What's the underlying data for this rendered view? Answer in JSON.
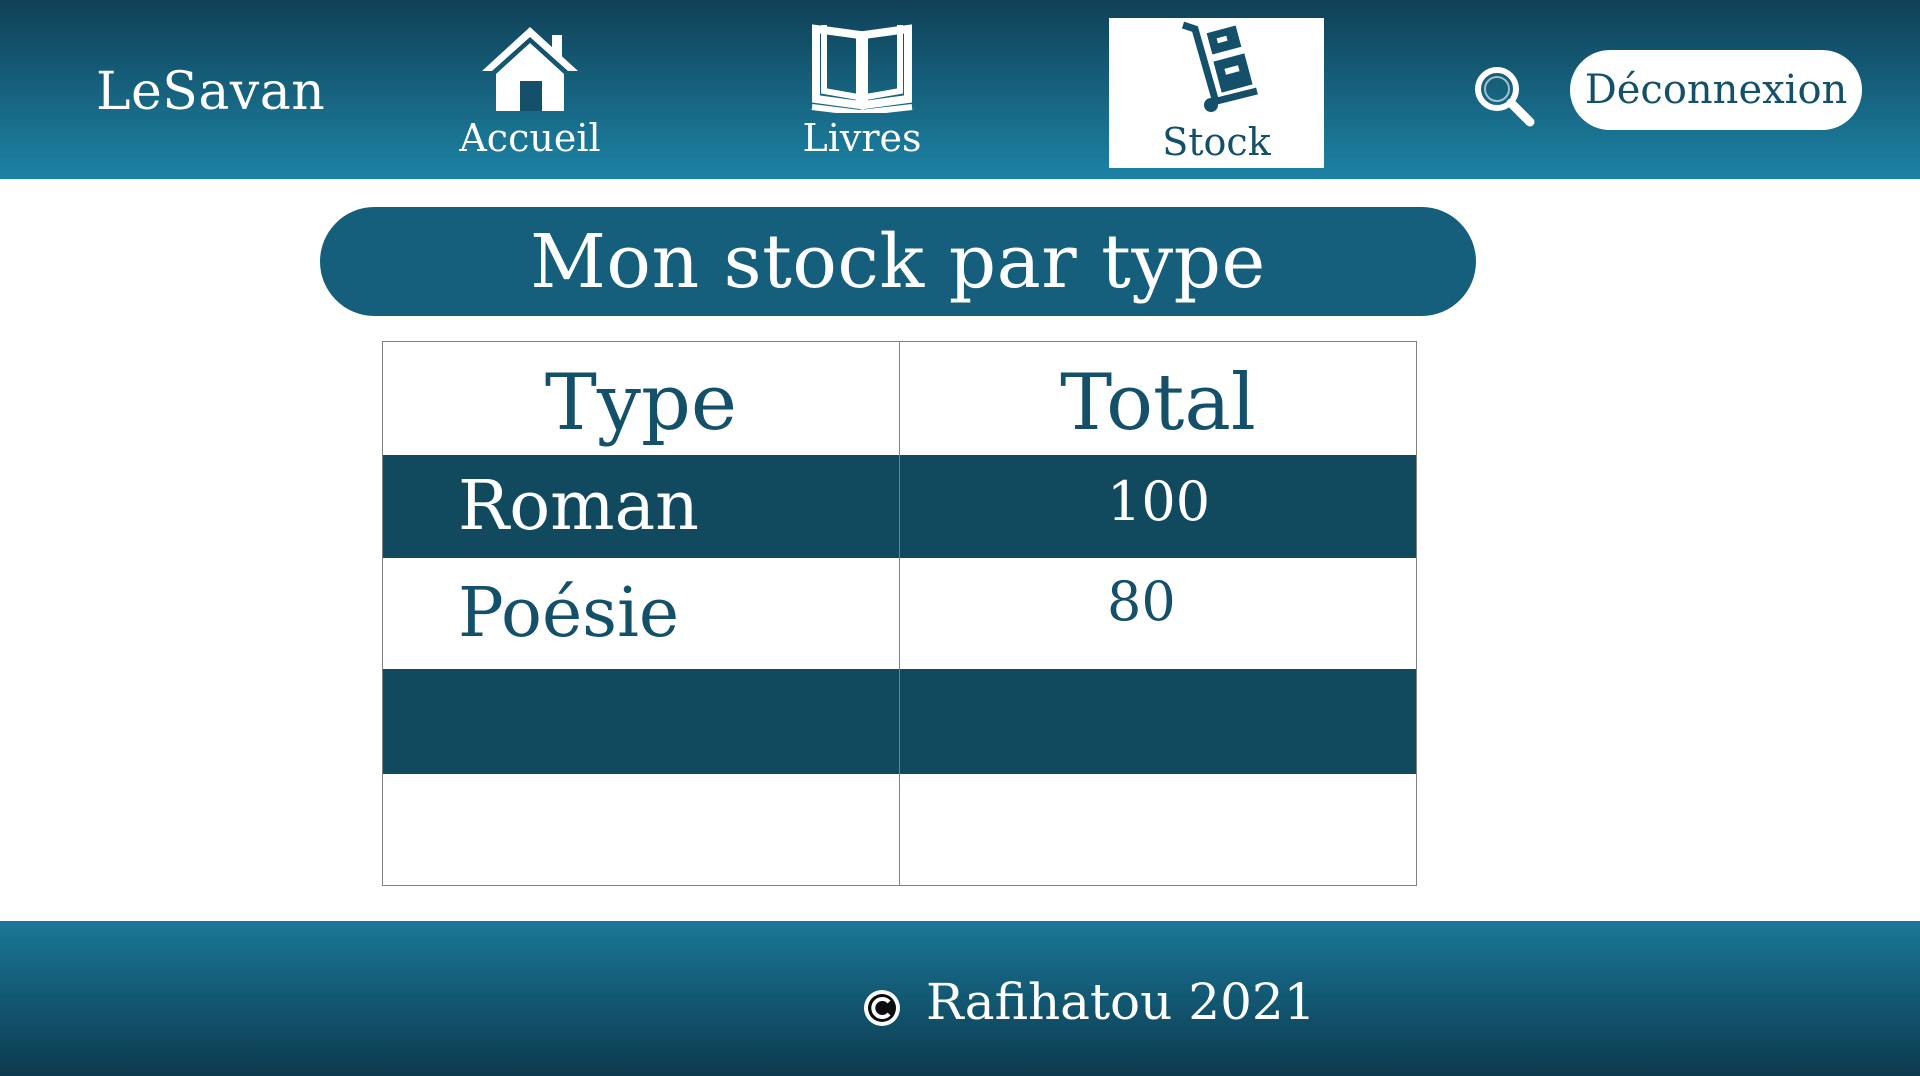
{
  "header": {
    "logo": "LeSavan",
    "nav": [
      {
        "label": "Accueil",
        "icon": "home-icon"
      },
      {
        "label": "Livres",
        "icon": "book-icon"
      },
      {
        "label": "Stock",
        "icon": "hand-truck-icon",
        "active": true
      }
    ],
    "search_icon": "search-icon",
    "logout_label": "Déconnexion"
  },
  "main": {
    "title": "Mon stock par type",
    "table": {
      "headers": [
        "Type",
        "Total"
      ],
      "rows": [
        {
          "type": "Roman",
          "total": "100"
        },
        {
          "type": "Poésie",
          "total": "80"
        },
        {
          "type": "",
          "total": ""
        },
        {
          "type": "",
          "total": ""
        }
      ]
    }
  },
  "footer": {
    "copyright_icon": "copyright-icon",
    "text": "Rafihatou 2021"
  },
  "colors": {
    "primary": "#155f7c",
    "dark_row": "#114a5f",
    "text_teal": "#15506a",
    "white": "#ffffff"
  }
}
